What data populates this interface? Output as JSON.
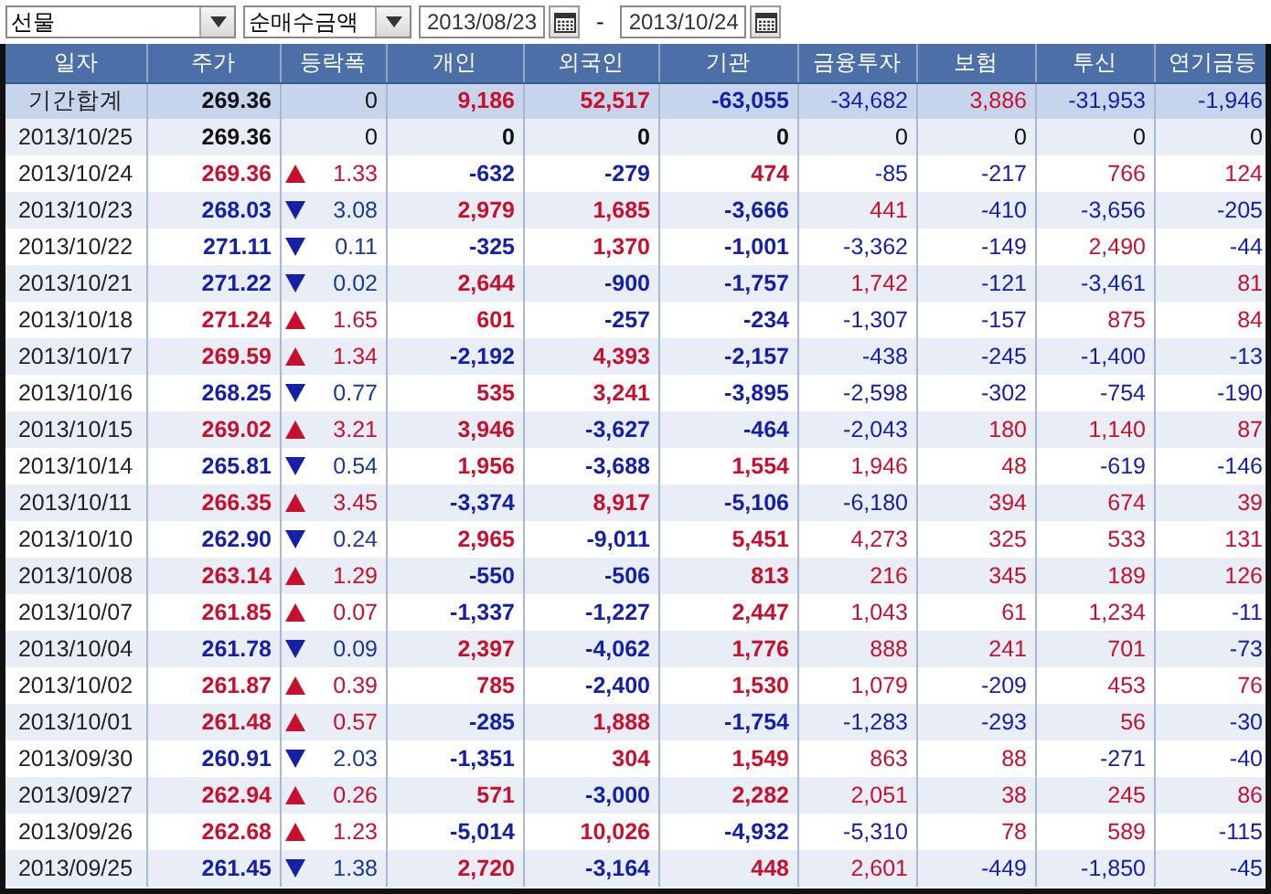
{
  "filters": {
    "market": "선물",
    "measure": "순매수금액",
    "start_date": "2013/08/23",
    "separator": "-",
    "end_date": "2013/10/24"
  },
  "columns": [
    "일자",
    "주가",
    "등락폭",
    "개인",
    "외국인",
    "기관",
    "금융투자",
    "보험",
    "투신",
    "연기금등"
  ],
  "rows": [
    {
      "kind": "total",
      "date": "기간합계",
      "price": "269.36",
      "up": false,
      "down": false,
      "change": "0",
      "values": [
        "9,186",
        "52,517",
        "-63,055",
        "-34,682",
        "3,886",
        "-31,953",
        "-1,946"
      ]
    },
    {
      "kind": "day",
      "date": "2013/10/25",
      "price": "269.36",
      "up": false,
      "down": false,
      "change": "0",
      "values": [
        "0",
        "0",
        "0",
        "0",
        "0",
        "0",
        "0"
      ]
    },
    {
      "kind": "day",
      "date": "2013/10/24",
      "price": "269.36",
      "up": true,
      "down": false,
      "change": "1.33",
      "values": [
        "-632",
        "-279",
        "474",
        "-85",
        "-217",
        "766",
        "124"
      ]
    },
    {
      "kind": "day",
      "date": "2013/10/23",
      "price": "268.03",
      "up": false,
      "down": true,
      "change": "3.08",
      "values": [
        "2,979",
        "1,685",
        "-3,666",
        "441",
        "-410",
        "-3,656",
        "-205"
      ]
    },
    {
      "kind": "day",
      "date": "2013/10/22",
      "price": "271.11",
      "up": false,
      "down": true,
      "change": "0.11",
      "values": [
        "-325",
        "1,370",
        "-1,001",
        "-3,362",
        "-149",
        "2,490",
        "-44"
      ]
    },
    {
      "kind": "day",
      "date": "2013/10/21",
      "price": "271.22",
      "up": false,
      "down": true,
      "change": "0.02",
      "values": [
        "2,644",
        "-900",
        "-1,757",
        "1,742",
        "-121",
        "-3,461",
        "81"
      ]
    },
    {
      "kind": "day",
      "date": "2013/10/18",
      "price": "271.24",
      "up": true,
      "down": false,
      "change": "1.65",
      "values": [
        "601",
        "-257",
        "-234",
        "-1,307",
        "-157",
        "875",
        "84"
      ]
    },
    {
      "kind": "day",
      "date": "2013/10/17",
      "price": "269.59",
      "up": true,
      "down": false,
      "change": "1.34",
      "values": [
        "-2,192",
        "4,393",
        "-2,157",
        "-438",
        "-245",
        "-1,400",
        "-13"
      ]
    },
    {
      "kind": "day",
      "date": "2013/10/16",
      "price": "268.25",
      "up": false,
      "down": true,
      "change": "0.77",
      "values": [
        "535",
        "3,241",
        "-3,895",
        "-2,598",
        "-302",
        "-754",
        "-190"
      ]
    },
    {
      "kind": "day",
      "date": "2013/10/15",
      "price": "269.02",
      "up": true,
      "down": false,
      "change": "3.21",
      "values": [
        "3,946",
        "-3,627",
        "-464",
        "-2,043",
        "180",
        "1,140",
        "87"
      ]
    },
    {
      "kind": "day",
      "date": "2013/10/14",
      "price": "265.81",
      "up": false,
      "down": true,
      "change": "0.54",
      "values": [
        "1,956",
        "-3,688",
        "1,554",
        "1,946",
        "48",
        "-619",
        "-146"
      ]
    },
    {
      "kind": "day",
      "date": "2013/10/11",
      "price": "266.35",
      "up": true,
      "down": false,
      "change": "3.45",
      "values": [
        "-3,374",
        "8,917",
        "-5,106",
        "-6,180",
        "394",
        "674",
        "39"
      ]
    },
    {
      "kind": "day",
      "date": "2013/10/10",
      "price": "262.90",
      "up": false,
      "down": true,
      "change": "0.24",
      "values": [
        "2,965",
        "-9,011",
        "5,451",
        "4,273",
        "325",
        "533",
        "131"
      ]
    },
    {
      "kind": "day",
      "date": "2013/10/08",
      "price": "263.14",
      "up": true,
      "down": false,
      "change": "1.29",
      "values": [
        "-550",
        "-506",
        "813",
        "216",
        "345",
        "189",
        "126"
      ]
    },
    {
      "kind": "day",
      "date": "2013/10/07",
      "price": "261.85",
      "up": true,
      "down": false,
      "change": "0.07",
      "values": [
        "-1,337",
        "-1,227",
        "2,447",
        "1,043",
        "61",
        "1,234",
        "-11"
      ]
    },
    {
      "kind": "day",
      "date": "2013/10/04",
      "price": "261.78",
      "up": false,
      "down": true,
      "change": "0.09",
      "values": [
        "2,397",
        "-4,062",
        "1,776",
        "888",
        "241",
        "701",
        "-73"
      ]
    },
    {
      "kind": "day",
      "date": "2013/10/02",
      "price": "261.87",
      "up": true,
      "down": false,
      "change": "0.39",
      "values": [
        "785",
        "-2,400",
        "1,530",
        "1,079",
        "-209",
        "453",
        "76"
      ]
    },
    {
      "kind": "day",
      "date": "2013/10/01",
      "price": "261.48",
      "up": true,
      "down": false,
      "change": "0.57",
      "values": [
        "-285",
        "1,888",
        "-1,754",
        "-1,283",
        "-293",
        "56",
        "-30"
      ]
    },
    {
      "kind": "day",
      "date": "2013/09/30",
      "price": "260.91",
      "up": false,
      "down": true,
      "change": "2.03",
      "values": [
        "-1,351",
        "304",
        "1,549",
        "863",
        "88",
        "-271",
        "-40"
      ]
    },
    {
      "kind": "day",
      "date": "2013/09/27",
      "price": "262.94",
      "up": true,
      "down": false,
      "change": "0.26",
      "values": [
        "571",
        "-3,000",
        "2,282",
        "2,051",
        "38",
        "245",
        "86"
      ]
    },
    {
      "kind": "day",
      "date": "2013/09/26",
      "price": "262.68",
      "up": true,
      "down": false,
      "change": "1.23",
      "values": [
        "-5,014",
        "10,026",
        "-4,932",
        "-5,310",
        "78",
        "589",
        "-115"
      ]
    },
    {
      "kind": "day",
      "date": "2013/09/25",
      "price": "261.45",
      "up": false,
      "down": true,
      "change": "1.38",
      "values": [
        "2,720",
        "-3,164",
        "448",
        "2,601",
        "-449",
        "-1,850",
        "-45"
      ]
    }
  ]
}
